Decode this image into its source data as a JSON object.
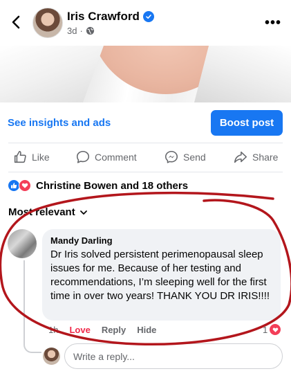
{
  "header": {
    "author": "Iris Crawford",
    "time": "3d",
    "separator": "·"
  },
  "post_actions": {
    "insights": "See insights and ads",
    "boost": "Boost post"
  },
  "actions": {
    "like": "Like",
    "comment": "Comment",
    "send": "Send",
    "share": "Share"
  },
  "reactions": {
    "summary": "Christine Bowen and 18 others"
  },
  "sort": {
    "label": "Most relevant"
  },
  "comment": {
    "author": "Mandy Darling",
    "text": "Dr Iris solved persistent perimenopausal sleep issues for me. Because of her testing and recommendations, I’m sleeping well for the first time in over two years! THANK YOU DR IRIS!!!!",
    "time": "1h",
    "love": "Love",
    "reply": "Reply",
    "hide": "Hide",
    "reaction_count": "1"
  },
  "reply_box": {
    "placeholder": "Write a reply..."
  },
  "colors": {
    "brand_blue": "#1877f2",
    "love_red": "#f33e58",
    "annotation_red": "#b3161c"
  }
}
